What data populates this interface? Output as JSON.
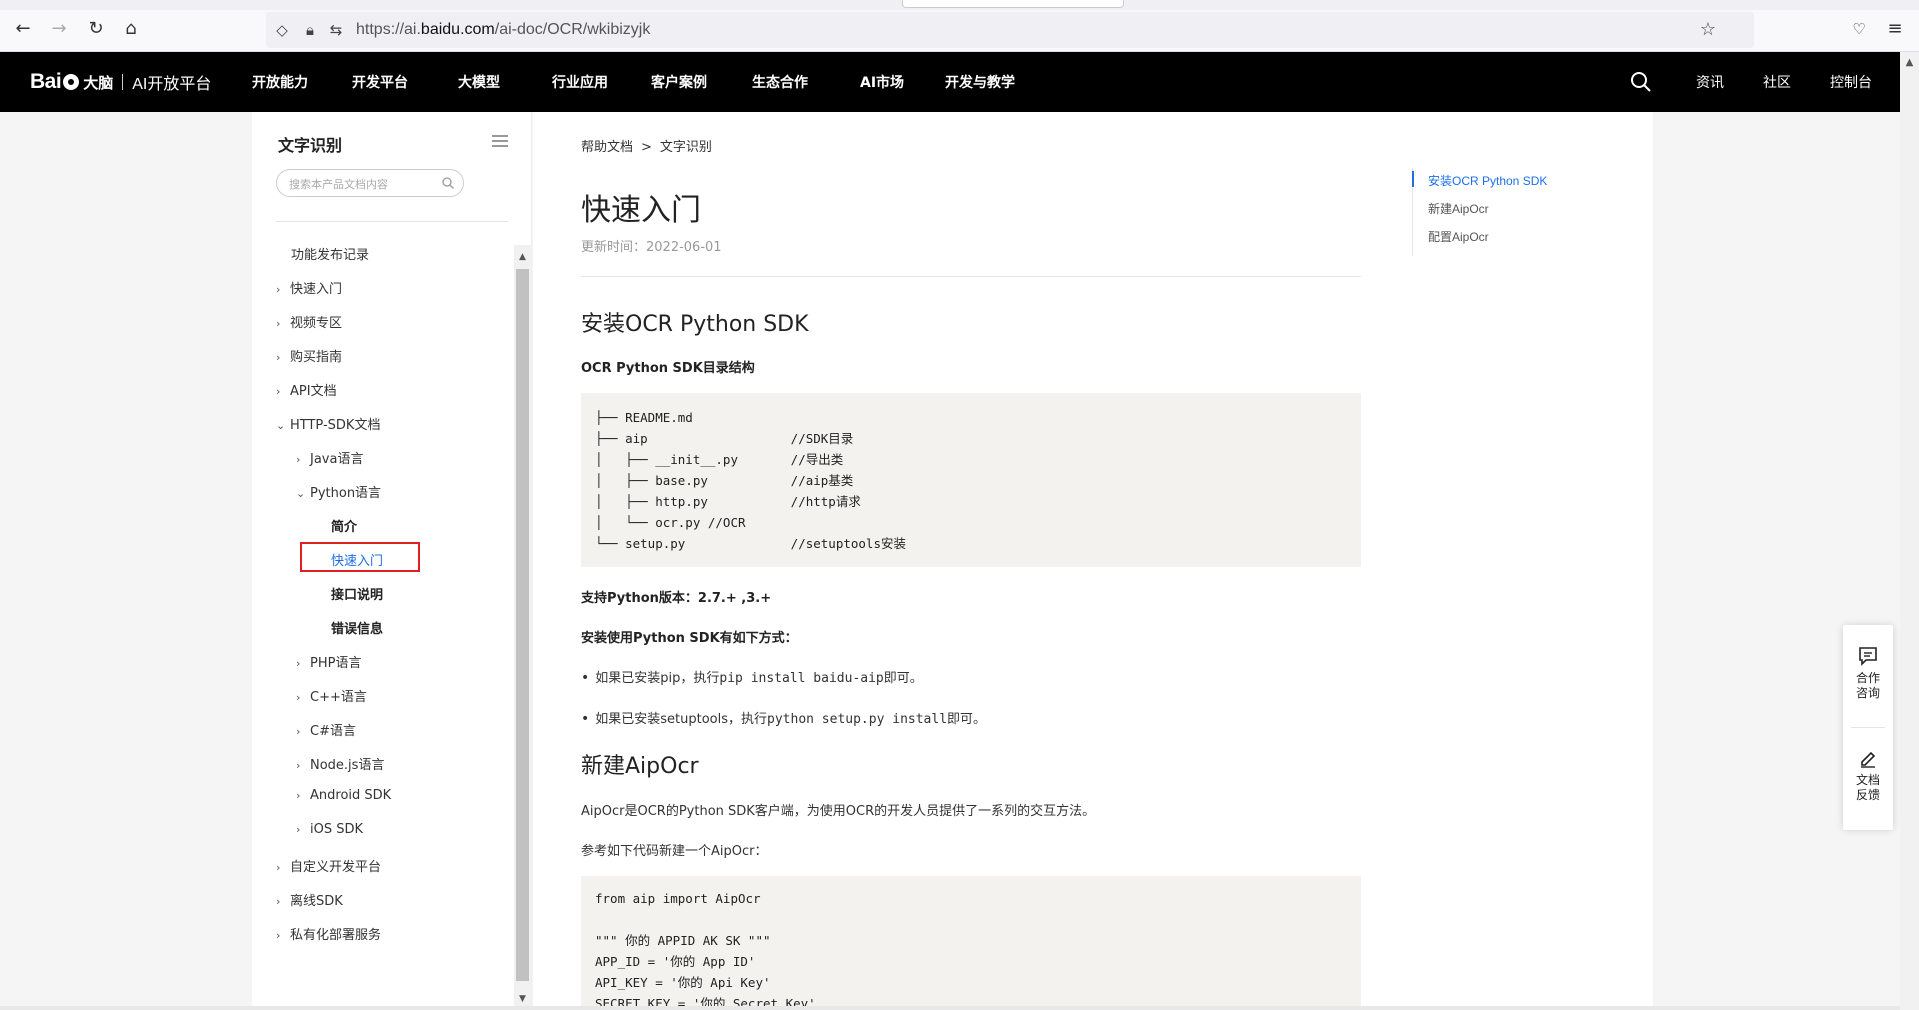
{
  "browser": {
    "url_prefix": "https://ai.",
    "url_domain": "baidu.com",
    "url_path": "/ai-doc/OCR/wkibizyjk"
  },
  "site_nav": {
    "logo_text": "Bai",
    "logo_brain": "大脑",
    "logo_sub": "AI开放平台",
    "items": [
      "开放能力",
      "开发平台",
      "大模型",
      "行业应用",
      "客户案例",
      "生态合作",
      "AI市场",
      "开发与教学"
    ],
    "right_items": [
      "资讯",
      "社区",
      "控制台"
    ]
  },
  "sidebar": {
    "title": "文字识别",
    "search_placeholder": "搜索本产品文档内容",
    "items": [
      {
        "label": "功能发布记录"
      },
      {
        "label": "快速入门"
      },
      {
        "label": "视频专区"
      },
      {
        "label": "购买指南"
      },
      {
        "label": "API文档"
      },
      {
        "label": "HTTP-SDK文档"
      },
      {
        "label": "Java语言"
      },
      {
        "label": "Python语言"
      },
      {
        "label": "简介"
      },
      {
        "label": "快速入门"
      },
      {
        "label": "接口说明"
      },
      {
        "label": "错误信息"
      },
      {
        "label": "PHP语言"
      },
      {
        "label": "C++语言"
      },
      {
        "label": "C#语言"
      },
      {
        "label": "Node.js语言"
      },
      {
        "label": "Android SDK"
      },
      {
        "label": "iOS SDK"
      },
      {
        "label": "自定义开发平台"
      },
      {
        "label": "离线SDK"
      },
      {
        "label": "私有化部署服务"
      }
    ]
  },
  "main": {
    "breadcrumb": [
      "帮助文档",
      ">",
      "文字识别"
    ],
    "title": "快速入门",
    "update_time": "更新时间：2022-06-01",
    "section1_title": "安装OCR Python SDK",
    "section1_sub": "OCR Python SDK目录结构",
    "code1": "├── README.md\n├── aip                   //SDK目录\n│   ├── __init__.py       //导出类\n│   ├── base.py           //aip基类\n│   ├── http.py           //http请求\n│   └── ocr.py //OCR\n└── setup.py              //setuptools安装",
    "python_version": "支持Python版本：2.7.+ ,3.+",
    "install_ways": "安装使用Python SDK有如下方式：",
    "bullet1_pre": "如果已安装pip，执行",
    "bullet1_code": "pip install baidu-aip",
    "bullet1_post": "即可。",
    "bullet2_pre": "如果已安装setuptools，执行",
    "bullet2_code": "python setup.py install",
    "bullet2_post": "即可。",
    "section2_title": "新建AipOcr",
    "section2_desc": "AipOcr是OCR的Python SDK客户端，为使用OCR的开发人员提供了一系列的交互方法。",
    "section2_ref": "参考如下代码新建一个AipOcr：",
    "code2": "from aip import AipOcr\n\n\"\"\" 你的 APPID AK SK \"\"\"\nAPP_ID = '你的 App ID'\nAPI_KEY = '你的 Api Key'\nSECRET_KEY = '你的 Secret Key'"
  },
  "toc": {
    "items": [
      "安装OCR Python SDK",
      "新建AipOcr",
      "配置AipOcr"
    ]
  },
  "float_widget": {
    "consult_line1": "合作",
    "consult_line2": "咨询",
    "feedback_line1": "文档",
    "feedback_line2": "反馈"
  }
}
